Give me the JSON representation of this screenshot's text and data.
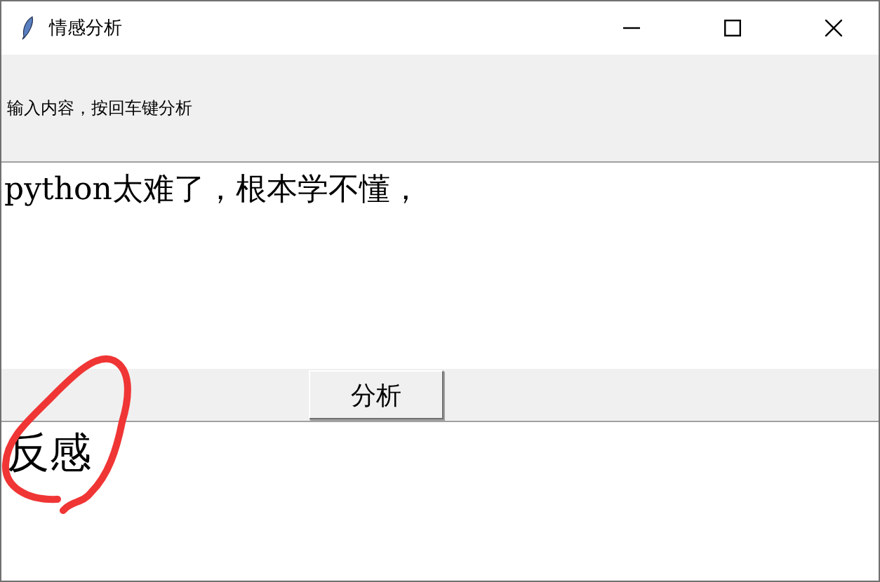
{
  "window": {
    "title": "情感分析"
  },
  "prompt": "输入内容，按回车键分析",
  "input": {
    "value": "python太难了，根本学不懂，"
  },
  "button": "分析",
  "result": "反感"
}
